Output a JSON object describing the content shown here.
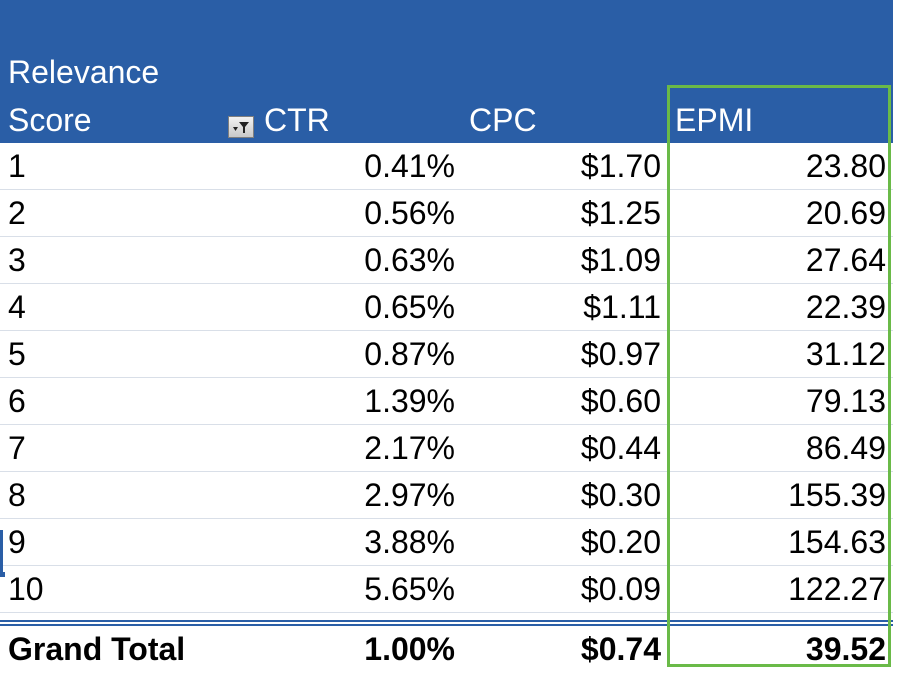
{
  "header": {
    "relevance_line1": "Relevance",
    "relevance_line2": "Score",
    "ctr": "CTR",
    "cpc": "CPC",
    "epmi": "EPMI",
    "filter_icon": "filter-dropdown-icon"
  },
  "rows": [
    {
      "score": "1",
      "ctr": "0.41%",
      "cpc": "$1.70",
      "epmi": "23.80"
    },
    {
      "score": "2",
      "ctr": "0.56%",
      "cpc": "$1.25",
      "epmi": "20.69"
    },
    {
      "score": "3",
      "ctr": "0.63%",
      "cpc": "$1.09",
      "epmi": "27.64"
    },
    {
      "score": "4",
      "ctr": "0.65%",
      "cpc": "$1.11",
      "epmi": "22.39"
    },
    {
      "score": "5",
      "ctr": "0.87%",
      "cpc": "$0.97",
      "epmi": "31.12"
    },
    {
      "score": "6",
      "ctr": "1.39%",
      "cpc": "$0.60",
      "epmi": "79.13"
    },
    {
      "score": "7",
      "ctr": "2.17%",
      "cpc": "$0.44",
      "epmi": "86.49"
    },
    {
      "score": "8",
      "ctr": "2.97%",
      "cpc": "$0.30",
      "epmi": "155.39"
    },
    {
      "score": "9",
      "ctr": "3.88%",
      "cpc": "$0.20",
      "epmi": "154.63"
    },
    {
      "score": "10",
      "ctr": "5.65%",
      "cpc": "$0.09",
      "epmi": "122.27"
    }
  ],
  "total": {
    "label": "Grand Total",
    "ctr": "1.00%",
    "cpc": "$0.74",
    "epmi": "39.52"
  },
  "colors": {
    "header_bg": "#2a5ea6",
    "highlight_border": "#6aba48"
  }
}
